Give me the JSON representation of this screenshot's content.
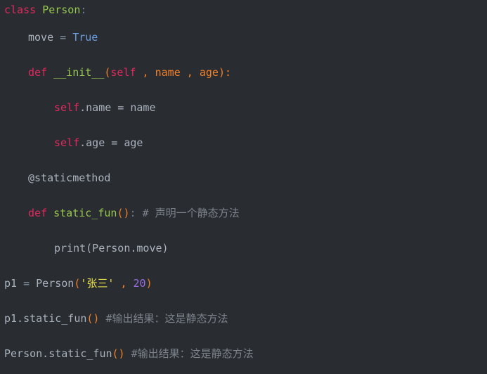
{
  "editor": {
    "language": "python",
    "background_color": "#292c30",
    "default_text_color": "#a9b2bd",
    "colors": {
      "keyword": "#e2295e",
      "definition_name": "#97c750",
      "identifier": "#a9b2bd",
      "operator": "#8c98a6",
      "punctuation": "#f0812a",
      "parameter": "#f0812a",
      "self_keyword": "#e2295e",
      "boolean": "#6a9ddf",
      "string": "#e8e04a",
      "number": "#9a6ee0",
      "comment": "#7b828b"
    }
  },
  "code": {
    "line1": {
      "keyword": "class",
      "space1": " ",
      "name": "Person",
      "colon": ":"
    },
    "line2": {
      "identifier": "move",
      "operator": " = ",
      "boolean": "True"
    },
    "line3": {
      "keyword": "def",
      "space1": " ",
      "name": "__init__",
      "paren_open": "(",
      "self": "self",
      "comma1": " , ",
      "param1": "name",
      "comma2": " , ",
      "param2": "age",
      "paren_close": "):"
    },
    "line4": {
      "self": "self",
      "rest": ".name = name"
    },
    "line5": {
      "self": "self",
      "rest": ".age = age"
    },
    "line6": {
      "decorator": "@staticmethod"
    },
    "line7": {
      "keyword": "def",
      "space1": " ",
      "name": "static_fun",
      "parens": "()",
      "colon": ":",
      "space2": " ",
      "comment": "# 声明一个静态方法"
    },
    "line8": {
      "text": "print(Person.move)"
    },
    "line9": {
      "identifier": "p1",
      "operator": " = ",
      "callee": "Person",
      "paren_open": "(",
      "string": "'张三'",
      "comma": " , ",
      "number": "20",
      "paren_close": ")"
    },
    "line10": {
      "identifier": "p1.static_fun",
      "parens": "()",
      "space": " ",
      "comment": "#输出结果：这是静态方法"
    },
    "line11": {
      "identifier": "Person.static_fun",
      "parens": "()",
      "space": " ",
      "comment": "#输出结果：这是静态方法"
    }
  }
}
